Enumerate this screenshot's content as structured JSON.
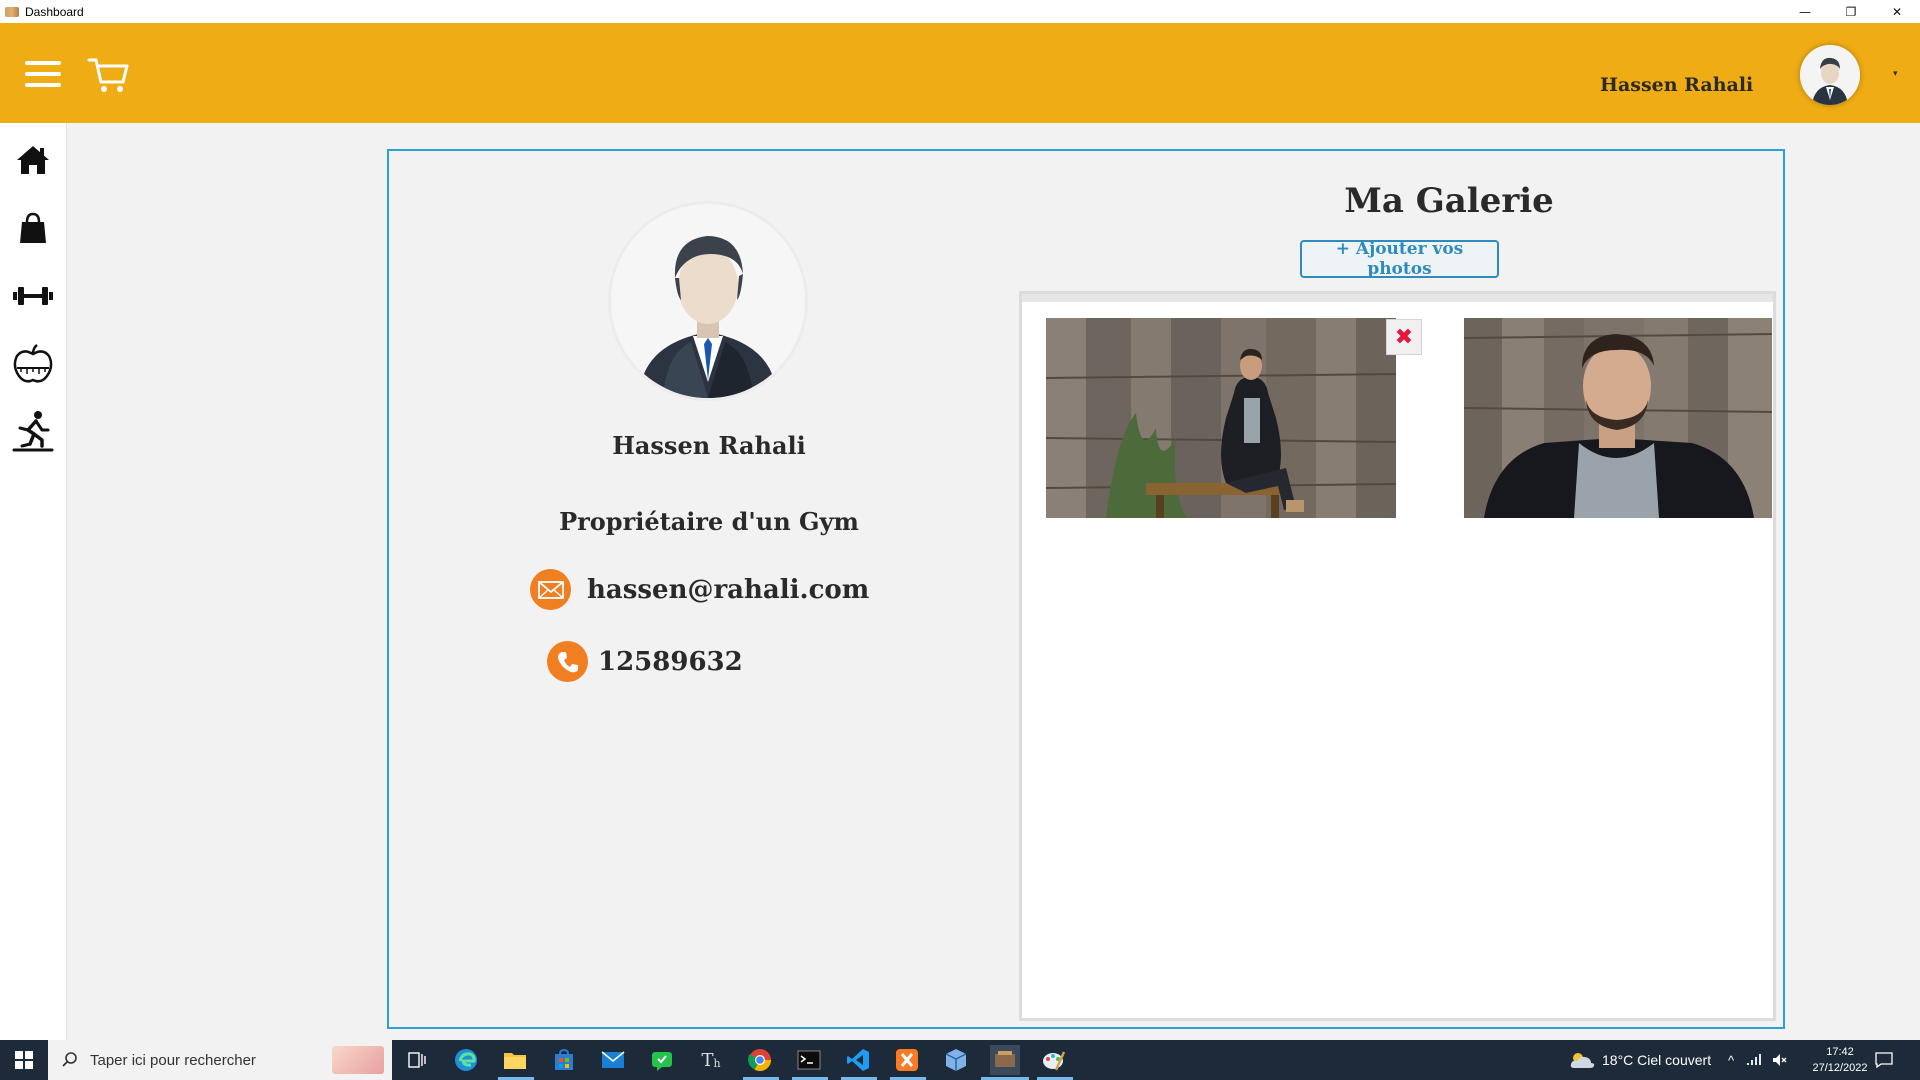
{
  "window": {
    "title": "Dashboard",
    "controls": {
      "minimize": "—",
      "restore": "❐",
      "close": "✕"
    }
  },
  "header": {
    "user_name": "Hassen Rahali",
    "dropdown": "▾",
    "color": "#efac14"
  },
  "sidebar": {
    "items": [
      {
        "icon": "home-icon"
      },
      {
        "icon": "shopping-bag-icon"
      },
      {
        "icon": "dumbbell-icon"
      },
      {
        "icon": "apple-icon"
      },
      {
        "icon": "running-icon"
      }
    ]
  },
  "profile": {
    "name": "Hassen Rahali",
    "role": "Propriétaire d'un Gym",
    "email": "hassen@rahali.com",
    "phone": "12589632"
  },
  "gallery": {
    "title": "Ma Galerie",
    "add_button": "+ Ajouter vos photos",
    "delete": "✖",
    "photos": [
      {
        "description": "man-sitting-bench-wood-wall"
      },
      {
        "description": "man-portrait-wood-wall"
      }
    ]
  },
  "taskbar": {
    "search_placeholder": "Taper ici pour rechercher",
    "weather": "18°C  Ciel couvert",
    "time": "17:42",
    "date": "27/12/2022"
  },
  "colors": {
    "accent": "#efac14",
    "panel_border": "#2ea0d8",
    "contact_icon": "#f07f22",
    "delete": "#e8163c"
  }
}
